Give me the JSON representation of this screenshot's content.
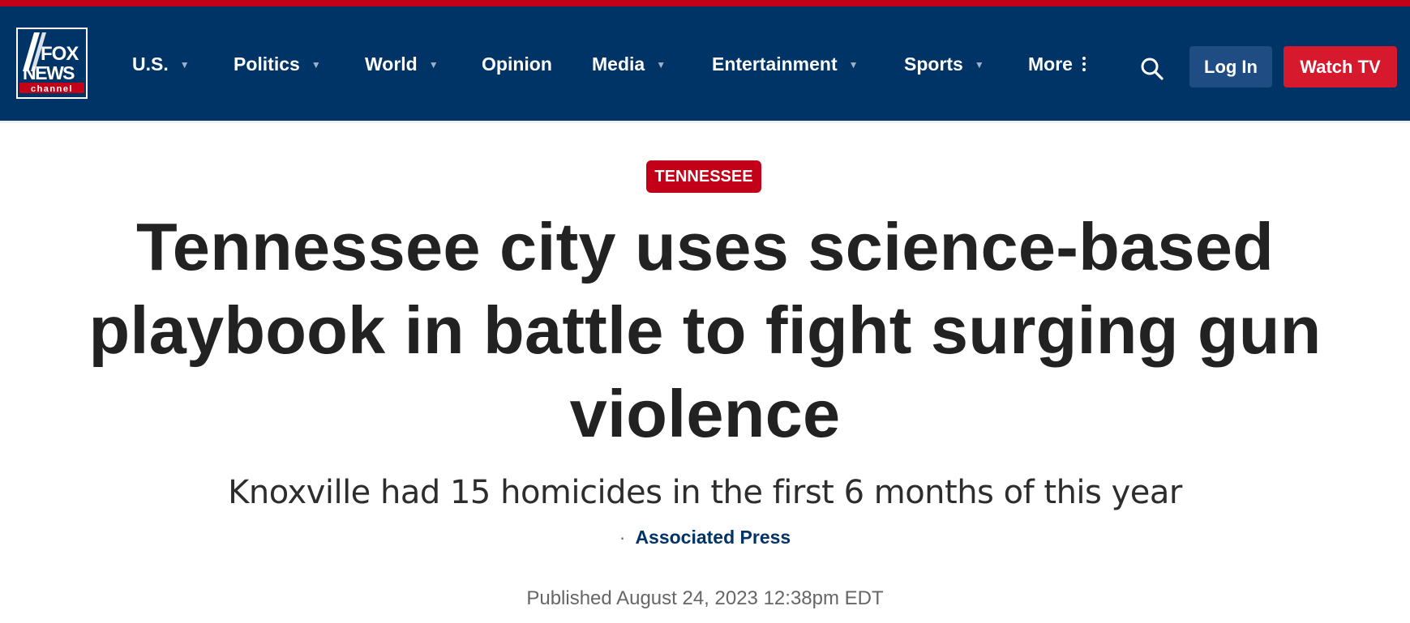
{
  "colors": {
    "brand_navy": "#003366",
    "brand_red": "#c20017",
    "login_button": "#1f4c82",
    "watch_button": "#d7192d",
    "headline_text": "#222222"
  },
  "logo": {
    "line1": "FOX",
    "line2": "NEWS",
    "line3": "channel",
    "icon": "fox-news-logo-icon"
  },
  "nav": {
    "items": [
      {
        "label": "U.S.",
        "has_dropdown": true
      },
      {
        "label": "Politics",
        "has_dropdown": true
      },
      {
        "label": "World",
        "has_dropdown": true
      },
      {
        "label": "Opinion",
        "has_dropdown": false
      },
      {
        "label": "Media",
        "has_dropdown": true
      },
      {
        "label": "Entertainment",
        "has_dropdown": true
      },
      {
        "label": "Sports",
        "has_dropdown": true
      },
      {
        "label": "More",
        "has_dropdown": false,
        "icon": "more-vertical-icon"
      }
    ],
    "dropdown_icon": "caret-down-icon",
    "search_icon": "search-icon",
    "login_label": "Log In",
    "watch_label": "Watch TV"
  },
  "article": {
    "kicker": "TENNESSEE",
    "headline": "Tennessee city uses science-based playbook in battle to fight surging gun violence",
    "subheadline": "Knoxville had 15 homicides in the first 6 months of this year",
    "byline_separator": "·",
    "author": "Associated Press",
    "published": "Published August 24, 2023 12:38pm EDT"
  }
}
